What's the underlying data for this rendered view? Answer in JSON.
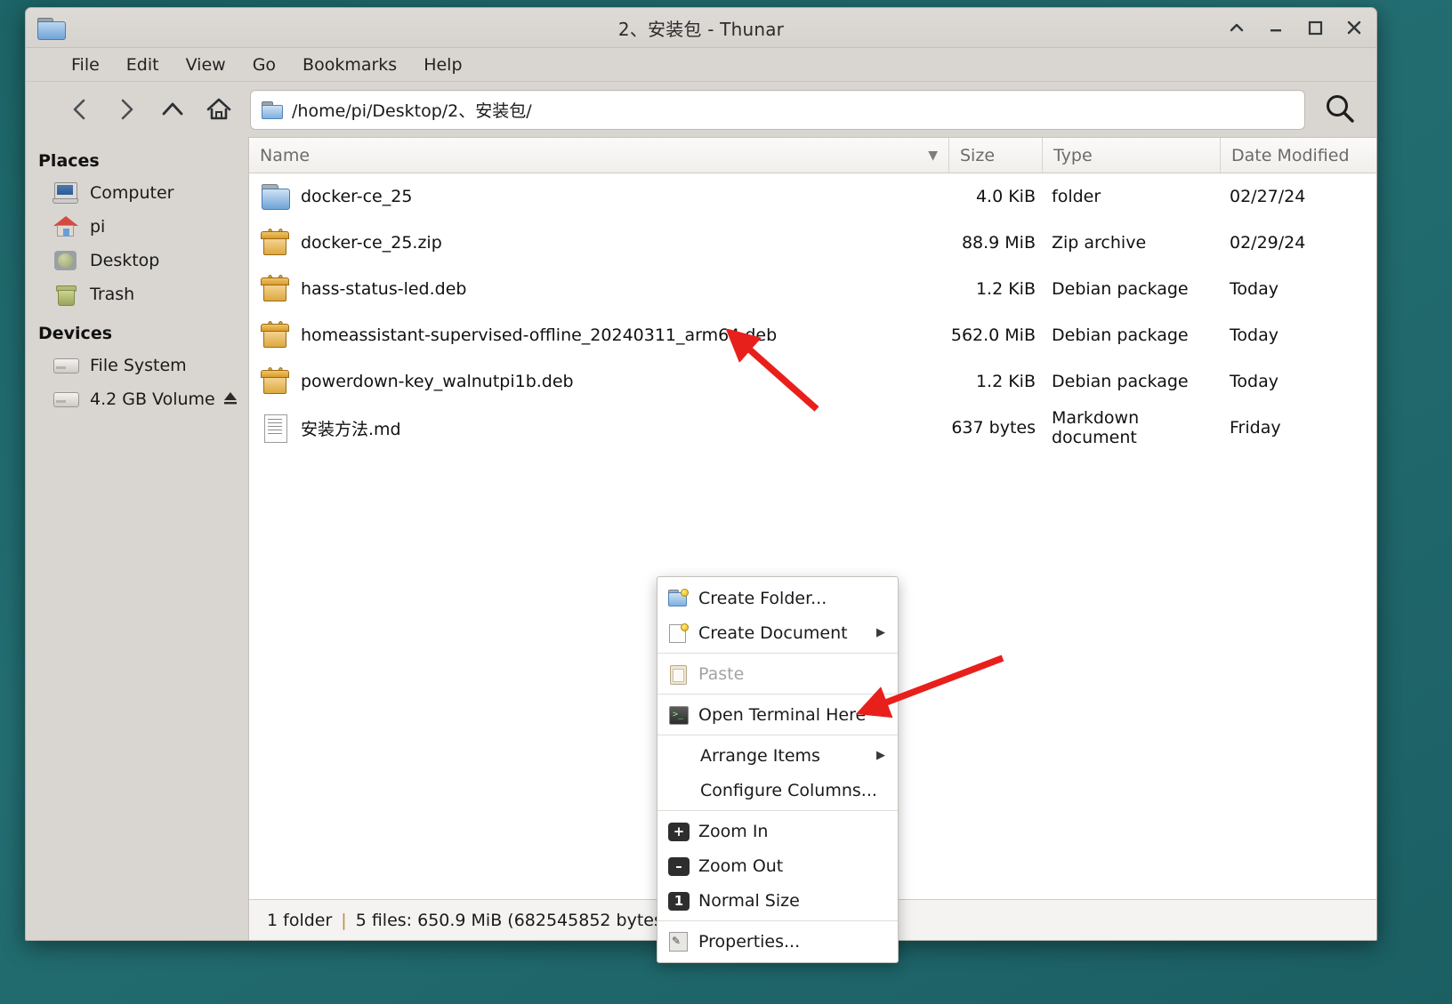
{
  "window": {
    "title": "2、安装包 - Thunar",
    "app_icon": "folder-icon",
    "controls": {
      "shade": "shade-icon",
      "minimize": "minimize-icon",
      "maximize": "maximize-icon",
      "close": "close-icon"
    }
  },
  "menubar": {
    "items": [
      {
        "label": "File"
      },
      {
        "label": "Edit"
      },
      {
        "label": "View"
      },
      {
        "label": "Go"
      },
      {
        "label": "Bookmarks"
      },
      {
        "label": "Help"
      }
    ]
  },
  "toolbar": {
    "back": "back-icon",
    "forward": "forward-icon",
    "up": "up-icon",
    "home": "home-icon",
    "path": "/home/pi/Desktop/2、安装包/",
    "search": "search-icon"
  },
  "sidebar": {
    "places_header": "Places",
    "places": [
      {
        "label": "Computer",
        "icon": "computer-icon"
      },
      {
        "label": "pi",
        "icon": "home-icon"
      },
      {
        "label": "Desktop",
        "icon": "desktop-icon"
      },
      {
        "label": "Trash",
        "icon": "trash-icon"
      }
    ],
    "devices_header": "Devices",
    "devices": [
      {
        "label": "File System",
        "icon": "drive-icon",
        "eject": false
      },
      {
        "label": "4.2 GB Volume",
        "icon": "drive-icon",
        "eject": true
      }
    ]
  },
  "filelist": {
    "columns": [
      {
        "label": "Name",
        "sorted": true,
        "sort_icon": "chevron-down-icon"
      },
      {
        "label": "Size"
      },
      {
        "label": "Type"
      },
      {
        "label": "Date Modified"
      }
    ],
    "rows": [
      {
        "name": "docker-ce_25",
        "size": "4.0 KiB",
        "type": "folder",
        "date": "02/27/24",
        "icon": "folder-icon"
      },
      {
        "name": "docker-ce_25.zip",
        "size": "88.9 MiB",
        "type": "Zip archive",
        "date": "02/29/24",
        "icon": "package-icon"
      },
      {
        "name": "hass-status-led.deb",
        "size": "1.2 KiB",
        "type": "Debian package",
        "date": "Today",
        "icon": "package-icon"
      },
      {
        "name": "homeassistant-supervised-offline_20240311_arm64.deb",
        "size": "562.0 MiB",
        "type": "Debian package",
        "date": "Today",
        "icon": "package-icon"
      },
      {
        "name": "powerdown-key_walnutpi1b.deb",
        "size": "1.2 KiB",
        "type": "Debian package",
        "date": "Today",
        "icon": "package-icon"
      },
      {
        "name": "安装方法.md",
        "size": "637 bytes",
        "type": "Markdown document",
        "date": "Friday",
        "icon": "document-icon"
      }
    ]
  },
  "statusbar": {
    "folders": "1 folder",
    "separator": "|",
    "files": "5 files: 650.9 MiB (682545852 bytes)"
  },
  "context_menu": {
    "items": [
      {
        "label": "Create Folder...",
        "icon": "new-folder-icon",
        "disabled": false,
        "submenu": false
      },
      {
        "label": "Create Document",
        "icon": "new-document-icon",
        "disabled": false,
        "submenu": true
      },
      {
        "label": "Paste",
        "icon": "paste-icon",
        "disabled": true,
        "submenu": false
      },
      {
        "label": "Open Terminal Here",
        "icon": "terminal-icon",
        "disabled": false,
        "submenu": false
      },
      {
        "label": "Arrange Items",
        "icon": null,
        "disabled": false,
        "submenu": true
      },
      {
        "label": "Configure Columns...",
        "icon": null,
        "disabled": false,
        "submenu": false
      },
      {
        "label": "Zoom In",
        "icon": "zoom-in-icon",
        "disabled": false,
        "submenu": false
      },
      {
        "label": "Zoom Out",
        "icon": "zoom-out-icon",
        "disabled": false,
        "submenu": false
      },
      {
        "label": "Normal Size",
        "icon": "normal-size-icon",
        "disabled": false,
        "submenu": false
      },
      {
        "label": "Properties...",
        "icon": "properties-icon",
        "disabled": false,
        "submenu": false
      }
    ],
    "separators_after": [
      1,
      2,
      3,
      5,
      8
    ]
  },
  "annotations": {
    "arrow_color": "#e8201c",
    "arrows": [
      {
        "name": "arrow-pointing-to-homeassistant-deb",
        "points_to": "homeassistant-supervised-offline_20240311_arm64.deb"
      },
      {
        "name": "arrow-pointing-to-open-terminal-here",
        "points_to": "Open Terminal Here"
      }
    ]
  },
  "colors": {
    "desktop": "#1f6b6e",
    "window_chrome": "#d9d6d1",
    "file_pane": "#ffffff",
    "accent_arrow": "#e8201c"
  }
}
